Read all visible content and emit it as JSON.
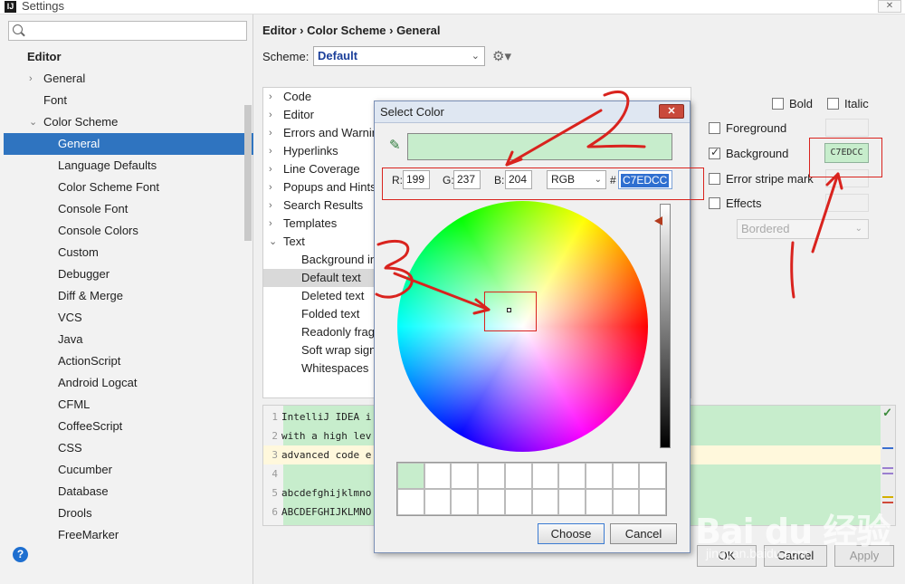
{
  "window": {
    "title": "Settings",
    "app_icon": "intellij-icon",
    "close_label": "✕"
  },
  "sidebar": {
    "search_placeholder": "",
    "section": "Editor",
    "items": [
      {
        "label": "General",
        "level": 1,
        "arrow": "›"
      },
      {
        "label": "Font",
        "level": 1
      },
      {
        "label": "Color Scheme",
        "level": 1,
        "arrow": "⌄"
      },
      {
        "label": "General",
        "level": 2,
        "selected": true
      },
      {
        "label": "Language Defaults",
        "level": 2
      },
      {
        "label": "Color Scheme Font",
        "level": 2
      },
      {
        "label": "Console Font",
        "level": 2
      },
      {
        "label": "Console Colors",
        "level": 2
      },
      {
        "label": "Custom",
        "level": 2
      },
      {
        "label": "Debugger",
        "level": 2
      },
      {
        "label": "Diff & Merge",
        "level": 2
      },
      {
        "label": "VCS",
        "level": 2
      },
      {
        "label": "Java",
        "level": 2
      },
      {
        "label": "ActionScript",
        "level": 2
      },
      {
        "label": "Android Logcat",
        "level": 2
      },
      {
        "label": "CFML",
        "level": 2
      },
      {
        "label": "CoffeeScript",
        "level": 2
      },
      {
        "label": "CSS",
        "level": 2
      },
      {
        "label": "Cucumber",
        "level": 2
      },
      {
        "label": "Database",
        "level": 2
      },
      {
        "label": "Drools",
        "level": 2
      },
      {
        "label": "FreeMarker",
        "level": 2
      }
    ],
    "help_label": "?"
  },
  "header": {
    "breadcrumb": "Editor › Color Scheme › General",
    "scheme_label": "Scheme:",
    "scheme_value": "Default",
    "gear_icon": "gear-icon"
  },
  "categories": [
    {
      "label": "Code",
      "level": 0,
      "arrow": "›"
    },
    {
      "label": "Editor",
      "level": 0,
      "arrow": "›"
    },
    {
      "label": "Errors and Warnin",
      "level": 0,
      "arrow": "›"
    },
    {
      "label": "Hyperlinks",
      "level": 0,
      "arrow": "›"
    },
    {
      "label": "Line Coverage",
      "level": 0,
      "arrow": "›"
    },
    {
      "label": "Popups and Hints",
      "level": 0,
      "arrow": "›"
    },
    {
      "label": "Search Results",
      "level": 0,
      "arrow": "›"
    },
    {
      "label": "Templates",
      "level": 0,
      "arrow": "›"
    },
    {
      "label": "Text",
      "level": 0,
      "arrow": "⌄"
    },
    {
      "label": "Background in",
      "level": 1
    },
    {
      "label": "Default text",
      "level": 1,
      "selected": true
    },
    {
      "label": "Deleted text",
      "level": 1
    },
    {
      "label": "Folded text",
      "level": 1
    },
    {
      "label": "Readonly fragi",
      "level": 1
    },
    {
      "label": "Soft wrap sign",
      "level": 1
    },
    {
      "label": "Whitespaces",
      "level": 1
    }
  ],
  "attributes": {
    "bold": "Bold",
    "italic": "Italic",
    "foreground": "Foreground",
    "background": "Background",
    "background_checked": true,
    "background_value": "C7EDCC",
    "error_stripe": "Error stripe mark",
    "effects": "Effects",
    "effect_type": "Bordered"
  },
  "preview": {
    "lines": [
      {
        "num": "1",
        "text": "IntelliJ IDEA i"
      },
      {
        "num": "2",
        "text": "with a high lev"
      },
      {
        "num": "3",
        "text": "advanced code e"
      },
      {
        "num": "4",
        "text": ""
      },
      {
        "num": "5",
        "text": "abcdefghijklmno"
      },
      {
        "num": "6",
        "text": "ABCDEFGHIJKLMNO"
      }
    ],
    "check_icon": "✓"
  },
  "buttons": {
    "ok": "OK",
    "cancel": "Cancel",
    "apply": "Apply"
  },
  "dialog": {
    "title": "Select Color",
    "close_label": "✕",
    "pipette_icon": "eyedropper-icon",
    "color": "#c7edcc",
    "r_label": "R:",
    "r_value": "199",
    "g_label": "G:",
    "g_value": "237",
    "b_label": "B:",
    "b_value": "204",
    "mode": "RGB",
    "hash": "#",
    "hex": "C7EDCC",
    "choose": "Choose",
    "cancel": "Cancel"
  },
  "watermark": {
    "text": "Bai du 经验",
    "sub": "jingyan.baidu.com"
  },
  "annotation_color": "#d9231e"
}
